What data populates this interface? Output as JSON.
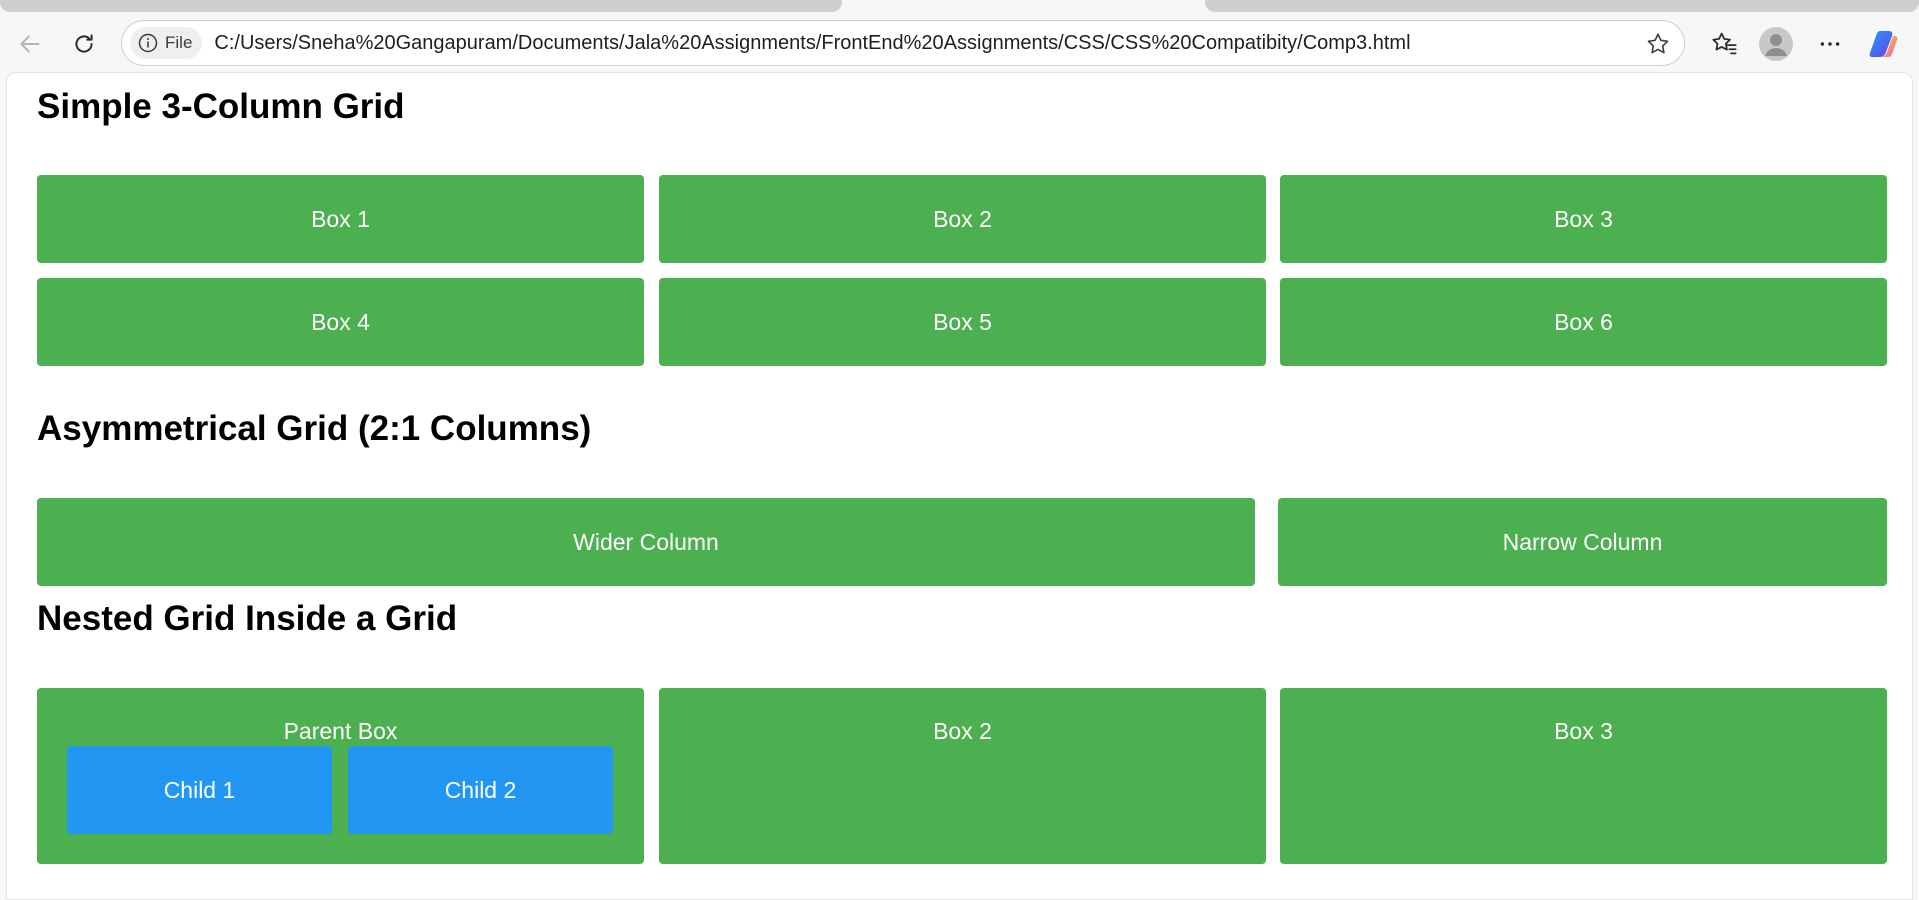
{
  "browser": {
    "site_chip_label": "File",
    "url": "C:/Users/Sneha%20Gangapuram/Documents/Jala%20Assignments/FrontEnd%20Assignments/CSS/CSS%20Compatibity/Comp3.html"
  },
  "page": {
    "section1": {
      "title": "Simple 3-Column Grid",
      "boxes": [
        "Box 1",
        "Box 2",
        "Box 3",
        "Box 4",
        "Box 5",
        "Box 6"
      ]
    },
    "section2": {
      "title": "Asymmetrical Grid (2:1 Columns)",
      "wide": "Wider Column",
      "narrow": "Narrow Column"
    },
    "section3": {
      "title": "Nested Grid Inside a Grid",
      "parent": "Parent Box",
      "children": [
        "Child 1",
        "Child 2"
      ],
      "box2": "Box 2",
      "box3": "Box 3"
    }
  },
  "colors": {
    "box_green": "#4caf50",
    "child_blue": "#2196f3"
  }
}
